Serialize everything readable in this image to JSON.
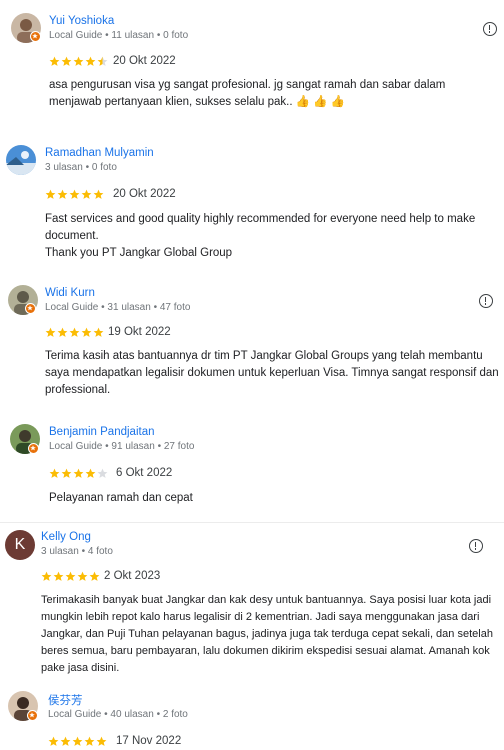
{
  "colors": {
    "accent": "#1a73e8",
    "star": "#fbbc04",
    "star_empty": "#dadce0",
    "local_guide_badge": "#e8710a"
  },
  "reviews": [
    {
      "name": "Yui Yoshioka",
      "meta": "Local Guide • 11 ulasan • 0 foto",
      "rating": 4.5,
      "date": "20 Okt 2022",
      "text": "asa pengurusan visa yg sangat profesional. jg sangat ramah dan sabar dalam menjawab pertanyaan klien, sukses selalu pak.. 👍 👍 👍",
      "avatar_icon": "person-photo-icon",
      "local_guide": true,
      "has_more_button": true
    },
    {
      "name": "Ramadhan Mulyamin",
      "meta": "3 ulasan • 0 foto",
      "rating": 5,
      "date": "20 Okt 2022",
      "text_lines": [
        "Fast services and good quality highly recommended for everyone need help to make document.",
        "Thank you PT Jangkar Global Group"
      ],
      "avatar_icon": "landscape-photo-icon",
      "local_guide": false,
      "has_more_button": false
    },
    {
      "name": "Widi Kurn",
      "meta": "Local Guide • 31 ulasan • 47 foto",
      "rating": 5,
      "date": "19 Okt 2022",
      "text": "Terima kasih atas bantuannya dr tim PT Jangkar Global Groups yang telah membantu saya mendapatkan legalisir dokumen untuk keperluan Visa. Timnya sangat responsif dan professional.",
      "avatar_icon": "person-photo-icon",
      "local_guide": true,
      "has_more_button": true
    },
    {
      "name": "Benjamin Pandjaitan",
      "meta": "Local Guide • 91 ulasan • 27 foto",
      "rating": 4,
      "date": "6 Okt 2022",
      "text": "Pelayanan ramah dan cepat",
      "avatar_icon": "person-photo-icon",
      "local_guide": true,
      "has_more_button": false
    },
    {
      "name": "Kelly Ong",
      "meta": "3 ulasan • 4 foto",
      "rating": 5,
      "date": "2 Okt 2023",
      "text": "Terimakasih banyak buat Jangkar dan kak desy untuk bantuannya. Saya posisi luar kota jadi mungkin lebih repot kalo harus legalisir di 2 kementrian. Jadi saya menggunakan jasa dari Jangkar, dan Puji Tuhan pelayanan bagus, jadinya juga tak terduga cepat sekali, dan setelah beres semua, baru pembayaran, lalu dokumen dikirim ekspedisi sesuai alamat. Amanah kok pake jasa disini.",
      "avatar_initial": "K",
      "avatar_color": "#6d3b34",
      "local_guide": false,
      "has_more_button": true
    },
    {
      "name": "侯芬芳",
      "meta": "Local Guide • 40 ulasan • 2 foto",
      "rating": 5,
      "date": "17 Nov 2022",
      "avatar_icon": "person-photo-icon",
      "local_guide": true,
      "has_more_button": false
    }
  ]
}
